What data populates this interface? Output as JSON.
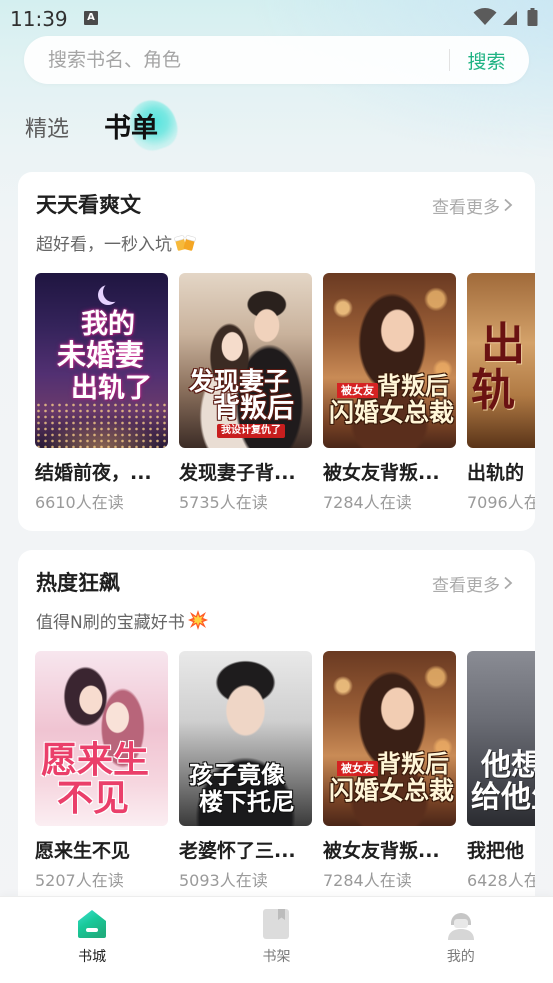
{
  "status_bar": {
    "time": "11:39",
    "notification_letter": "A",
    "icons": {
      "notification": "text-a-notification-icon",
      "wifi": "wifi-icon",
      "signal": "cell-signal-icon",
      "battery": "battery-icon"
    }
  },
  "search": {
    "placeholder": "搜索书名、角色",
    "button_label": "搜索"
  },
  "tabs": [
    {
      "label": "精选",
      "active": false
    },
    {
      "label": "书单",
      "active": true
    }
  ],
  "sections": [
    {
      "title": "天天看爽文",
      "more_label": "查看更多",
      "more_icon": "chevron-right-icon",
      "subtitle": "超好看，一秒入坑",
      "subtitle_icon": "clinking-beer-mugs-emoji-icon",
      "books": [
        {
          "title": "结婚前夜，...",
          "readers": "6610人在读",
          "cover_text": [
            "我的",
            "未婚妻",
            "出轨了"
          ]
        },
        {
          "title": "发现妻子背...",
          "readers": "5735人在读",
          "cover_text": [
            "发现妻子",
            "背叛后",
            "我设计复仇了"
          ]
        },
        {
          "title": "被女友背叛...",
          "readers": "7284人在读",
          "cover_text": [
            "被女友",
            "背叛后",
            "闪婚女总裁"
          ]
        },
        {
          "title": "出轨的",
          "readers": "7096人在",
          "cover_text": [
            "出",
            "轨"
          ]
        }
      ]
    },
    {
      "title": "热度狂飙",
      "more_label": "查看更多",
      "more_icon": "chevron-right-icon",
      "subtitle": "值得N刷的宝藏好书",
      "subtitle_icon": "collision-emoji-icon",
      "books": [
        {
          "title": "愿来生不见",
          "readers": "5207人在读",
          "cover_text": [
            "愿来生",
            "不见"
          ]
        },
        {
          "title": "老婆怀了三...",
          "readers": "5093人在读",
          "cover_text": [
            "孩子竟像",
            "楼下托尼"
          ]
        },
        {
          "title": "被女友背叛...",
          "readers": "7284人在读",
          "cover_text": [
            "被女友",
            "背叛后",
            "闪婚女总裁"
          ]
        },
        {
          "title": "我把他",
          "readers": "6428人在",
          "cover_text": [
            "他想",
            "给他生"
          ]
        }
      ]
    }
  ],
  "bottom_nav": [
    {
      "label": "书城",
      "icon": "bookstore-house-icon",
      "active": true
    },
    {
      "label": "书架",
      "icon": "bookshelf-book-icon",
      "active": false
    },
    {
      "label": "我的",
      "icon": "profile-person-icon",
      "active": false
    }
  ],
  "colors": {
    "accent": "#1fb383",
    "tab_highlight": "#56e4df",
    "nav_active_icon_start": "#19d2a0",
    "nav_active_icon_end": "#2aa6e0",
    "text_primary": "#1f1f1f",
    "text_secondary": "#9a9a9a"
  }
}
